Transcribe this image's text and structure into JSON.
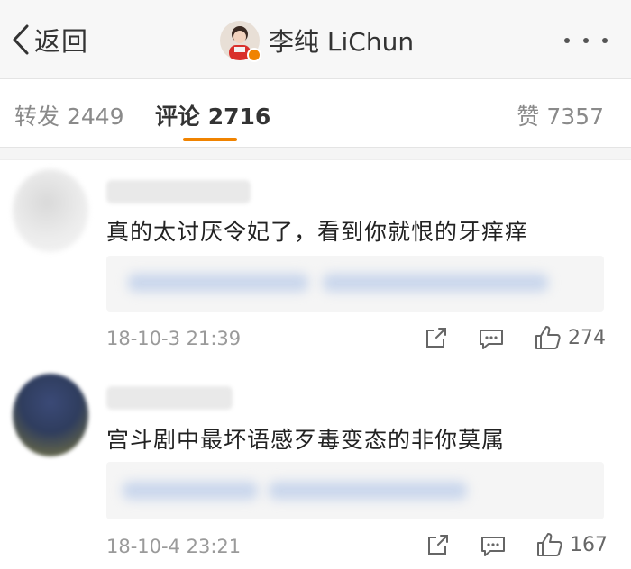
{
  "nav": {
    "back_label": "返回",
    "title": "李纯 LiChun"
  },
  "tabs": [
    {
      "label": "转发 2449",
      "active": false
    },
    {
      "label": "评论 2716",
      "active": true
    },
    {
      "label": "赞 7357",
      "active": false
    }
  ],
  "comments": [
    {
      "text": "真的太讨厌令妃了，看到你就恨的牙痒痒",
      "time": "18-10-3 21:39",
      "likes": "274"
    },
    {
      "text": "宫斗剧中最坏语感歹毒变态的非你莫属",
      "time": "18-10-4 23:21",
      "likes": "167"
    }
  ],
  "colors": {
    "accent": "#f08300",
    "navbar_bg": "#f7f7f7"
  },
  "icons": [
    "chevron-left-icon",
    "more-icon",
    "verified-icon",
    "share-icon",
    "reply-icon",
    "thumbs-up-icon"
  ]
}
